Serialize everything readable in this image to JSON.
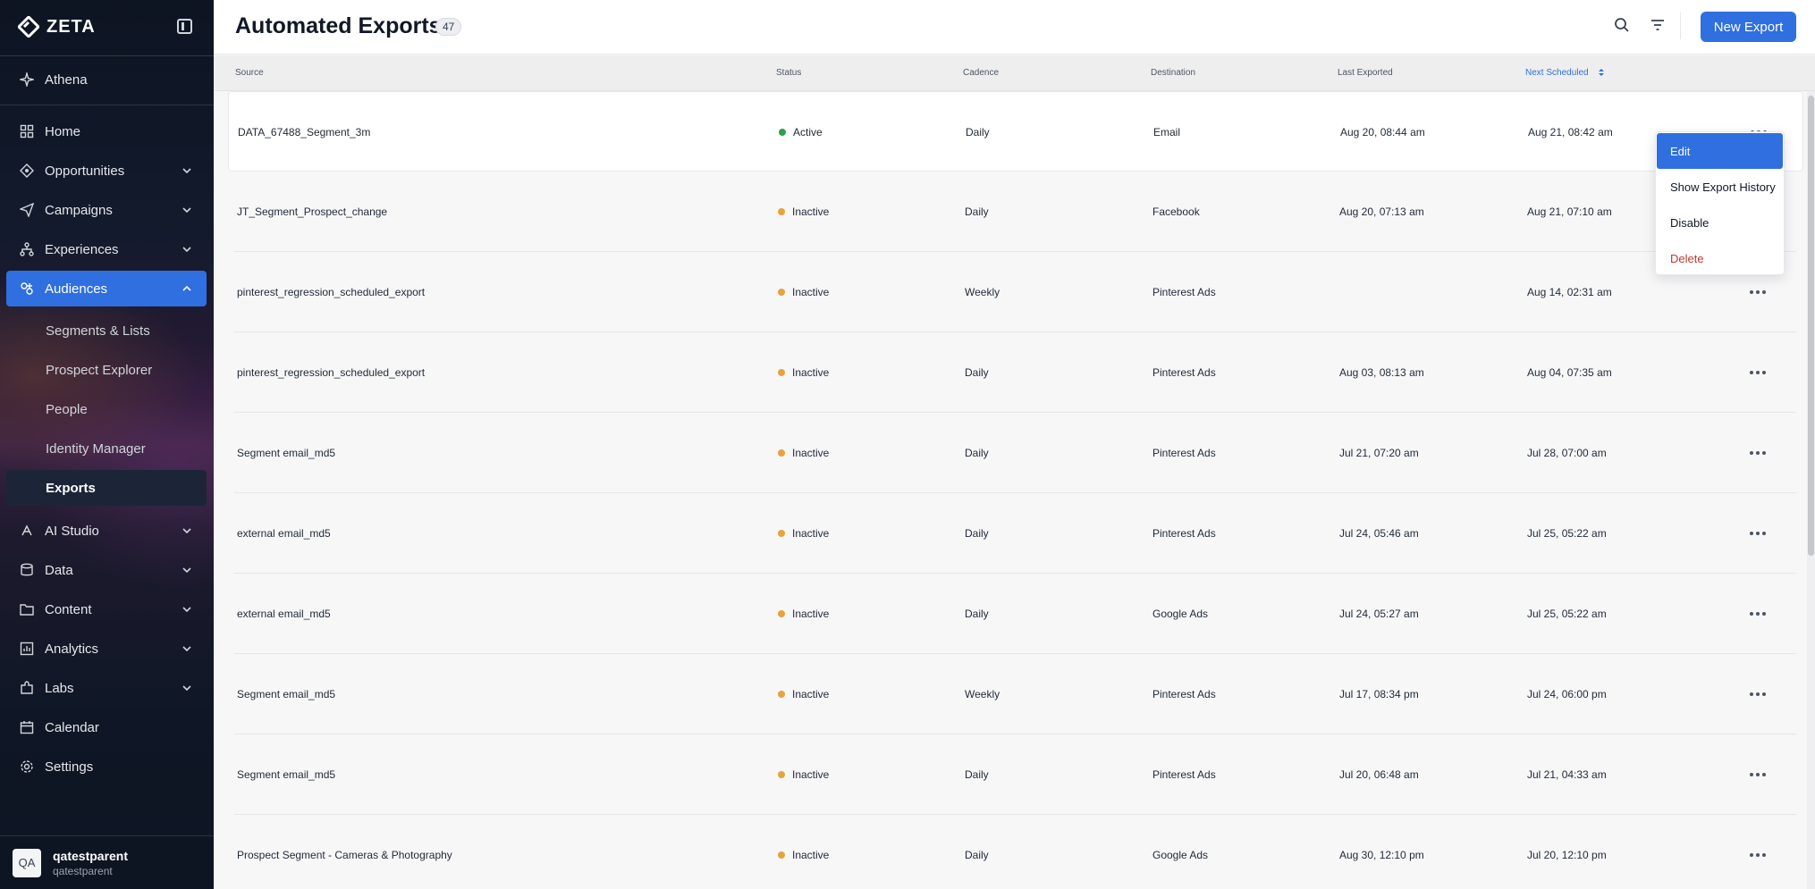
{
  "brand": {
    "name": "ZETA"
  },
  "sidebar": {
    "top_item": {
      "label": "Athena",
      "icon": "sparkle-icon"
    },
    "items": [
      {
        "label": "Home",
        "icon": "grid-icon",
        "expandable": false
      },
      {
        "label": "Opportunities",
        "icon": "diamond-icon",
        "expandable": true
      },
      {
        "label": "Campaigns",
        "icon": "send-icon",
        "expandable": true
      },
      {
        "label": "Experiences",
        "icon": "flow-icon",
        "expandable": true
      },
      {
        "label": "Audiences",
        "icon": "audience-icon",
        "expandable": true,
        "active": true
      },
      {
        "label": "AI Studio",
        "icon": "ai-icon",
        "expandable": true
      },
      {
        "label": "Data",
        "icon": "database-icon",
        "expandable": true
      },
      {
        "label": "Content",
        "icon": "folder-icon",
        "expandable": true
      },
      {
        "label": "Analytics",
        "icon": "chart-icon",
        "expandable": true
      },
      {
        "label": "Labs",
        "icon": "puzzle-icon",
        "expandable": true
      },
      {
        "label": "Calendar",
        "icon": "calendar-icon",
        "expandable": false
      },
      {
        "label": "Settings",
        "icon": "gear-icon",
        "expandable": false
      }
    ],
    "sub_items": [
      {
        "label": "Segments & Lists"
      },
      {
        "label": "Prospect Explorer"
      },
      {
        "label": "People"
      },
      {
        "label": "Identity Manager"
      },
      {
        "label": "Exports",
        "active": true
      }
    ]
  },
  "user": {
    "avatar": "QA",
    "name": "qatestparent",
    "org": "qatestparent"
  },
  "header": {
    "title": "Automated Exports",
    "count": "47",
    "new_button": "New Export"
  },
  "table": {
    "columns": [
      "Source",
      "Status",
      "Cadence",
      "Destination",
      "Last Exported",
      "Next Scheduled"
    ],
    "sorted_column": "Next Scheduled",
    "rows": [
      {
        "source": "DATA_67488_Segment_3m",
        "status": "Active",
        "cadence": "Daily",
        "destination": "Email",
        "last": "Aug 20, 08:44 am",
        "next": "Aug 21, 08:42 am"
      },
      {
        "source": "JT_Segment_Prospect_change",
        "status": "Inactive",
        "cadence": "Daily",
        "destination": "Facebook",
        "last": "Aug 20, 07:13 am",
        "next": "Aug 21, 07:10 am"
      },
      {
        "source": "pinterest_regression_scheduled_export",
        "status": "Inactive",
        "cadence": "Weekly",
        "destination": "Pinterest Ads",
        "last": "",
        "next": "Aug 14, 02:31 am"
      },
      {
        "source": "pinterest_regression_scheduled_export",
        "status": "Inactive",
        "cadence": "Daily",
        "destination": "Pinterest Ads",
        "last": "Aug 03, 08:13 am",
        "next": "Aug 04, 07:35 am"
      },
      {
        "source": "Segment email_md5",
        "status": "Inactive",
        "cadence": "Daily",
        "destination": "Pinterest Ads",
        "last": "Jul 21, 07:20 am",
        "next": "Jul 28, 07:00 am"
      },
      {
        "source": "external email_md5",
        "status": "Inactive",
        "cadence": "Daily",
        "destination": "Pinterest Ads",
        "last": "Jul 24, 05:46 am",
        "next": "Jul 25, 05:22 am"
      },
      {
        "source": "external email_md5",
        "status": "Inactive",
        "cadence": "Daily",
        "destination": "Google Ads",
        "last": "Jul 24, 05:27 am",
        "next": "Jul 25, 05:22 am"
      },
      {
        "source": "Segment email_md5",
        "status": "Inactive",
        "cadence": "Weekly",
        "destination": "Pinterest Ads",
        "last": "Jul 17, 08:34 pm",
        "next": "Jul 24, 06:00 pm"
      },
      {
        "source": "Segment email_md5",
        "status": "Inactive",
        "cadence": "Daily",
        "destination": "Pinterest Ads",
        "last": "Jul 20, 06:48 am",
        "next": "Jul 21, 04:33 am"
      },
      {
        "source": "Prospect Segment - Cameras & Photography",
        "status": "Inactive",
        "cadence": "Daily",
        "destination": "Google Ads",
        "last": "Aug 30, 12:10 pm",
        "next": "Jul 20, 12:10 pm"
      }
    ]
  },
  "context_menu": {
    "items": [
      {
        "label": "Edit",
        "highlighted": true
      },
      {
        "label": "Show Export History"
      },
      {
        "label": "Disable"
      },
      {
        "label": "Delete",
        "danger": true
      }
    ]
  },
  "colors": {
    "accent": "#2f6fe0",
    "active_dot": "#2e9e4f",
    "inactive_dot": "#e8a33d",
    "danger": "#c0392b"
  }
}
